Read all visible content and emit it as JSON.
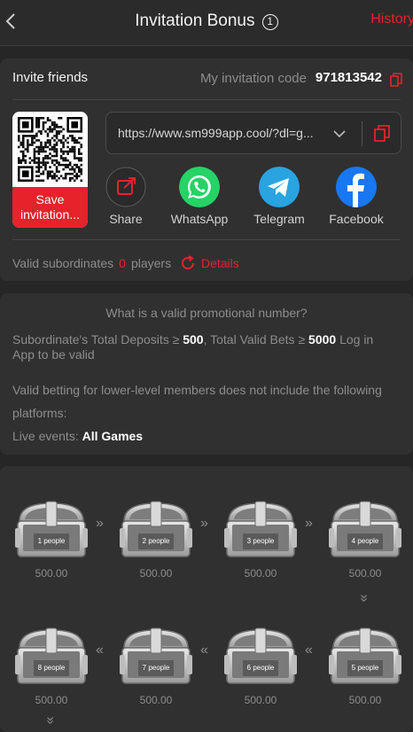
{
  "header": {
    "title": "Invitation Bonus",
    "info_glyph": "1",
    "history": "History"
  },
  "invite": {
    "title": "Invite friends",
    "code_label": "My invitation code",
    "code": "971813542",
    "qr_save": "Save invitation...",
    "link": "https://www.sm999app.cool/?dl=g...",
    "share": [
      {
        "label": "Share",
        "icon": "share-icon"
      },
      {
        "label": "WhatsApp",
        "icon": "whatsapp-icon"
      },
      {
        "label": "Telegram",
        "icon": "telegram-icon"
      },
      {
        "label": "Facebook",
        "icon": "facebook-icon"
      }
    ],
    "valid_label": "Valid subordinates",
    "valid_count": "0",
    "valid_unit": "players",
    "details": "Details"
  },
  "rules": {
    "question": "What is a valid promotional number?",
    "line1_a": "Subordinate's Total Deposits ≥",
    "line1_b": "500",
    "line1_c": ",  Total Valid Bets ≥",
    "line1_d": "5000",
    "line1_e": "Log in",
    "line2": "App to be valid",
    "line3": "Valid betting for lower-level members does not include the following",
    "line4": "platforms:",
    "line5_a": "Live events:",
    "line5_b": "All Games"
  },
  "chests": [
    {
      "label": "1 people",
      "value": "500.00"
    },
    {
      "label": "2 people",
      "value": "500.00"
    },
    {
      "label": "3 people",
      "value": "500.00"
    },
    {
      "label": "4 people",
      "value": "500.00"
    },
    {
      "label": "5 people",
      "value": "500.00"
    },
    {
      "label": "6 people",
      "value": "500.00"
    },
    {
      "label": "7 people",
      "value": "500.00"
    },
    {
      "label": "8 people",
      "value": "500.00"
    }
  ],
  "colors": {
    "accent": "#e8222b",
    "background": "#262626",
    "card": "#303030"
  }
}
